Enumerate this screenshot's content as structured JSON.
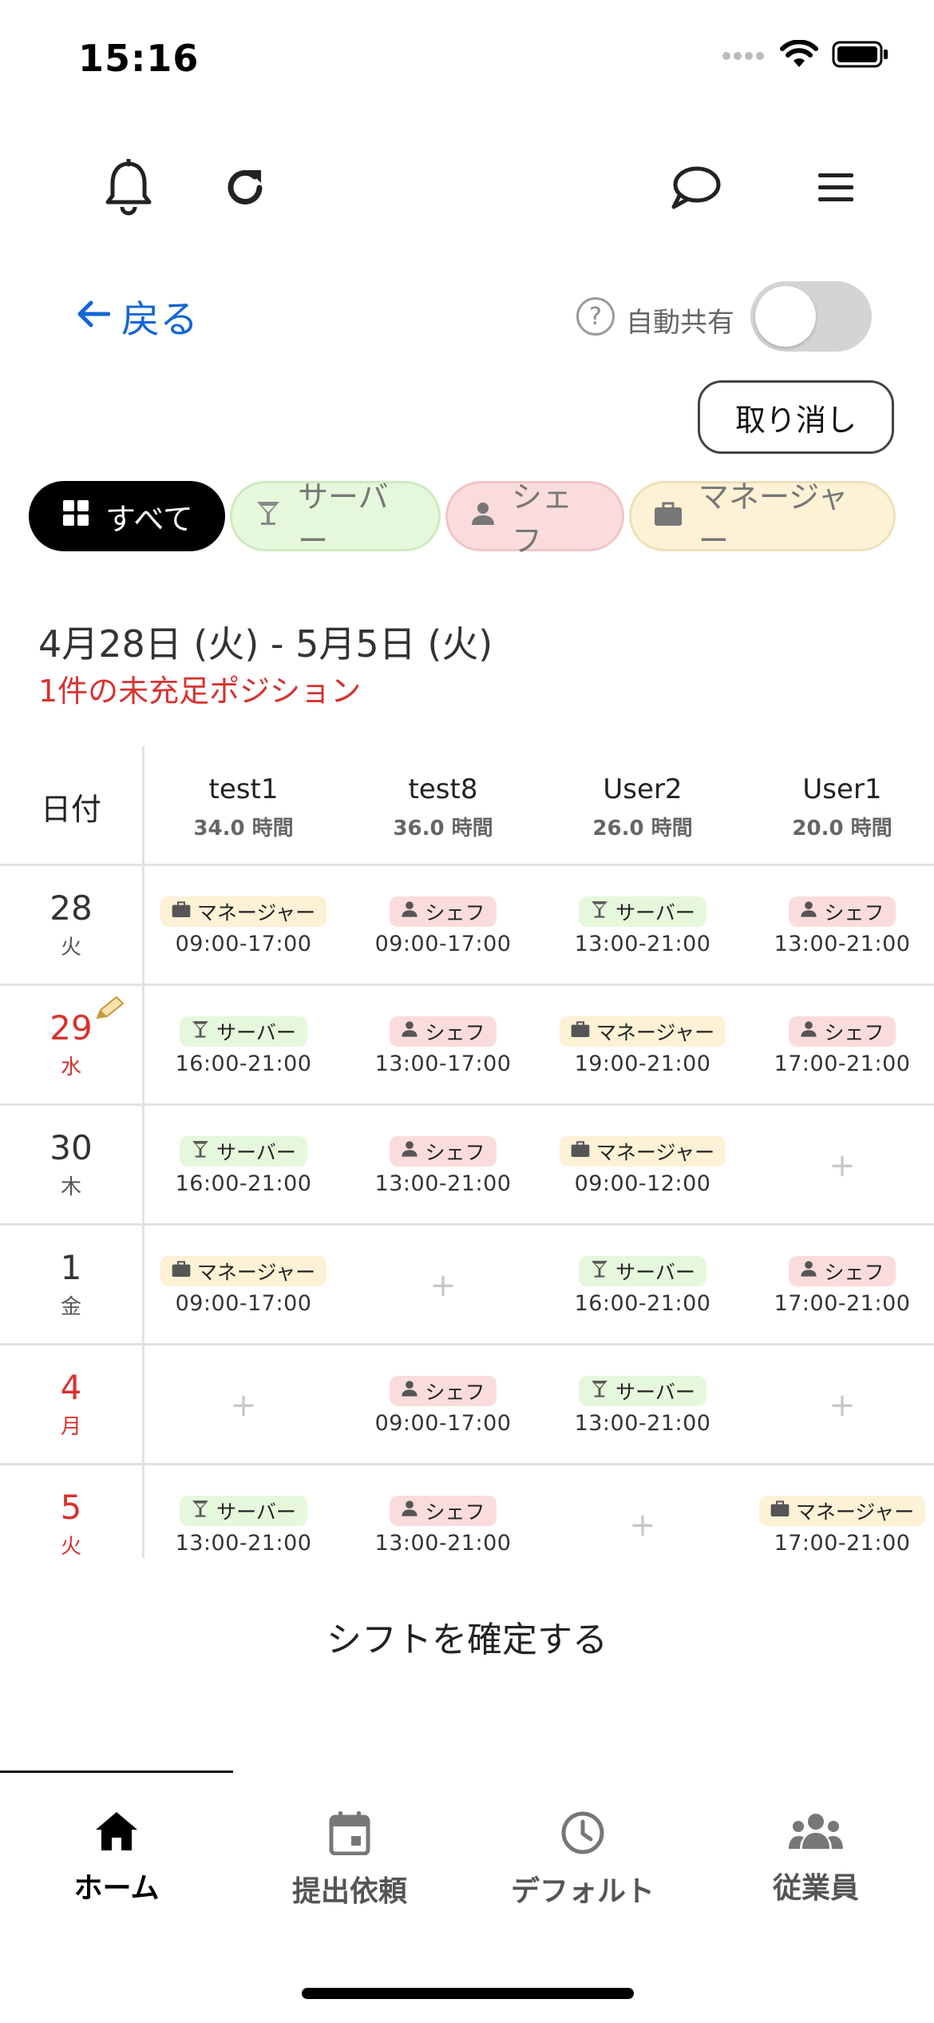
{
  "status": {
    "time": "15:16"
  },
  "back": {
    "label": "戻る"
  },
  "auto_share": {
    "help": "?",
    "label": "自動共有"
  },
  "cancel_label": "取り消し",
  "filters": [
    {
      "label": "すべて",
      "icon": "grid-icon"
    },
    {
      "label": "サーバー",
      "icon": "cocktail-icon"
    },
    {
      "label": "シェフ",
      "icon": "person-icon"
    },
    {
      "label": "マネージャー",
      "icon": "briefcase-icon"
    }
  ],
  "range": "4月28日 (火) - 5月5日 (火)",
  "unfilled": "1件の未充足ポジション",
  "grid": {
    "date_header": "日付",
    "employees": [
      {
        "name": "test1",
        "hours": "34.0 時間"
      },
      {
        "name": "test8",
        "hours": "36.0 時間"
      },
      {
        "name": "User2",
        "hours": "26.0 時間"
      },
      {
        "name": "User1",
        "hours": "20.0 時間"
      }
    ],
    "plus": "+",
    "rows": [
      {
        "day": "28",
        "wd": "火",
        "cells": [
          {
            "role": "マネージャー",
            "time": "09:00-17:00"
          },
          {
            "role": "シェフ",
            "time": "09:00-17:00"
          },
          {
            "role": "サーバー",
            "time": "13:00-21:00"
          },
          {
            "role": "シェフ",
            "time": "13:00-21:00"
          }
        ]
      },
      {
        "day": "29",
        "wd": "水",
        "cells": [
          {
            "role": "サーバー",
            "time": "16:00-21:00"
          },
          {
            "role": "シェフ",
            "time": "13:00-17:00"
          },
          {
            "role": "マネージャー",
            "time": "19:00-21:00"
          },
          {
            "role": "シェフ",
            "time": "17:00-21:00"
          }
        ]
      },
      {
        "day": "30",
        "wd": "木",
        "cells": [
          {
            "role": "サーバー",
            "time": "16:00-21:00"
          },
          {
            "role": "シェフ",
            "time": "13:00-21:00"
          },
          {
            "role": "マネージャー",
            "time": "09:00-12:00"
          },
          null
        ]
      },
      {
        "day": "1",
        "wd": "金",
        "cells": [
          {
            "role": "マネージャー",
            "time": "09:00-17:00"
          },
          null,
          {
            "role": "サーバー",
            "time": "16:00-21:00"
          },
          {
            "role": "シェフ",
            "time": "17:00-21:00"
          }
        ]
      },
      {
        "day": "4",
        "wd": "月",
        "cells": [
          null,
          {
            "role": "シェフ",
            "time": "09:00-17:00"
          },
          {
            "role": "サーバー",
            "time": "13:00-21:00"
          },
          null
        ]
      },
      {
        "day": "5",
        "wd": "火",
        "cells": [
          {
            "role": "サーバー",
            "time": "13:00-21:00"
          },
          {
            "role": "シェフ",
            "time": "13:00-21:00"
          },
          null,
          {
            "role": "マネージャー",
            "time": "17:00-21:00"
          }
        ]
      }
    ]
  },
  "confirm_label": "シフトを確定する",
  "tabs": [
    {
      "label": "ホーム",
      "icon": "home-icon"
    },
    {
      "label": "提出依頼",
      "icon": "calendar-icon"
    },
    {
      "label": "デフォルト",
      "icon": "clock-icon"
    },
    {
      "label": "従業員",
      "icon": "people-icon"
    }
  ],
  "colors": {
    "accent": "#1266d4",
    "alert": "#d6332f",
    "server": "#e6f8dc",
    "chef": "#fbdcdc",
    "manager": "#fdf1d6"
  }
}
